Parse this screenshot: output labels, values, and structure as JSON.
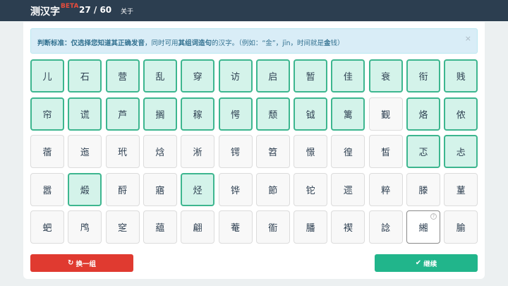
{
  "nav": {
    "brand": "测汉字",
    "beta": "BETA",
    "counter": "27 / 60",
    "about": "关于"
  },
  "alert": {
    "label": "判断标准：",
    "part1": "仅选择您知道其",
    "emph1": "正确发音",
    "part2": "，同时可用",
    "emph2": "其组词造句",
    "part3": "的汉字。（例如：“金”，jīn，时间就是",
    "emph3": "金",
    "part4": "钱）",
    "close": "×"
  },
  "grid": {
    "rows": [
      {
        "chars": [
          "儿",
          "石",
          "营",
          "乱",
          "穿",
          "访",
          "启",
          "暂",
          "佳",
          "衰",
          "衔",
          "贱"
        ]
      },
      {
        "chars": [
          "帘",
          "谎",
          "芦",
          "搁",
          "稼",
          "愕",
          "颓",
          "钺",
          "篱",
          "觐",
          "烙",
          "侬"
        ]
      },
      {
        "chars": [
          "蓿",
          "迤",
          "玳",
          "焓",
          "淅",
          "锷",
          "笤",
          "憬",
          "徨",
          "皙",
          "忑",
          "忐"
        ]
      },
      {
        "chars": [
          "嚣",
          "煅",
          "酹",
          "寤",
          "烃",
          "铧",
          "節",
          "铊",
          "遝",
          "粹",
          "滕",
          "蓳"
        ]
      },
      {
        "chars": [
          "蚆",
          "鸤",
          "窆",
          "藴",
          "翩",
          "菴",
          "衜",
          "膰",
          "褉",
          "諗",
          "緗",
          "腧"
        ]
      }
    ],
    "selected": [
      [
        true,
        true,
        true,
        true,
        true,
        true,
        true,
        true,
        true,
        true,
        true,
        true
      ],
      [
        true,
        true,
        true,
        true,
        true,
        true,
        true,
        true,
        true,
        false,
        true,
        true
      ],
      [
        false,
        false,
        false,
        false,
        false,
        false,
        false,
        false,
        false,
        false,
        true,
        true
      ],
      [
        false,
        true,
        false,
        false,
        true,
        false,
        false,
        false,
        false,
        false,
        false,
        false
      ],
      [
        false,
        false,
        false,
        false,
        false,
        false,
        false,
        false,
        false,
        false,
        false,
        false
      ]
    ],
    "help_badge": "?"
  },
  "buttons": {
    "refresh_icon": "refresh-icon",
    "refresh": "换一组",
    "continue_icon": "check-icon",
    "continue": "继续"
  },
  "colors": {
    "navbar": "#2c3e50",
    "selected_bg": "#d4f3ea",
    "selected_border": "#3db68f",
    "refresh": "#e03a30",
    "continue": "#21b58b"
  }
}
